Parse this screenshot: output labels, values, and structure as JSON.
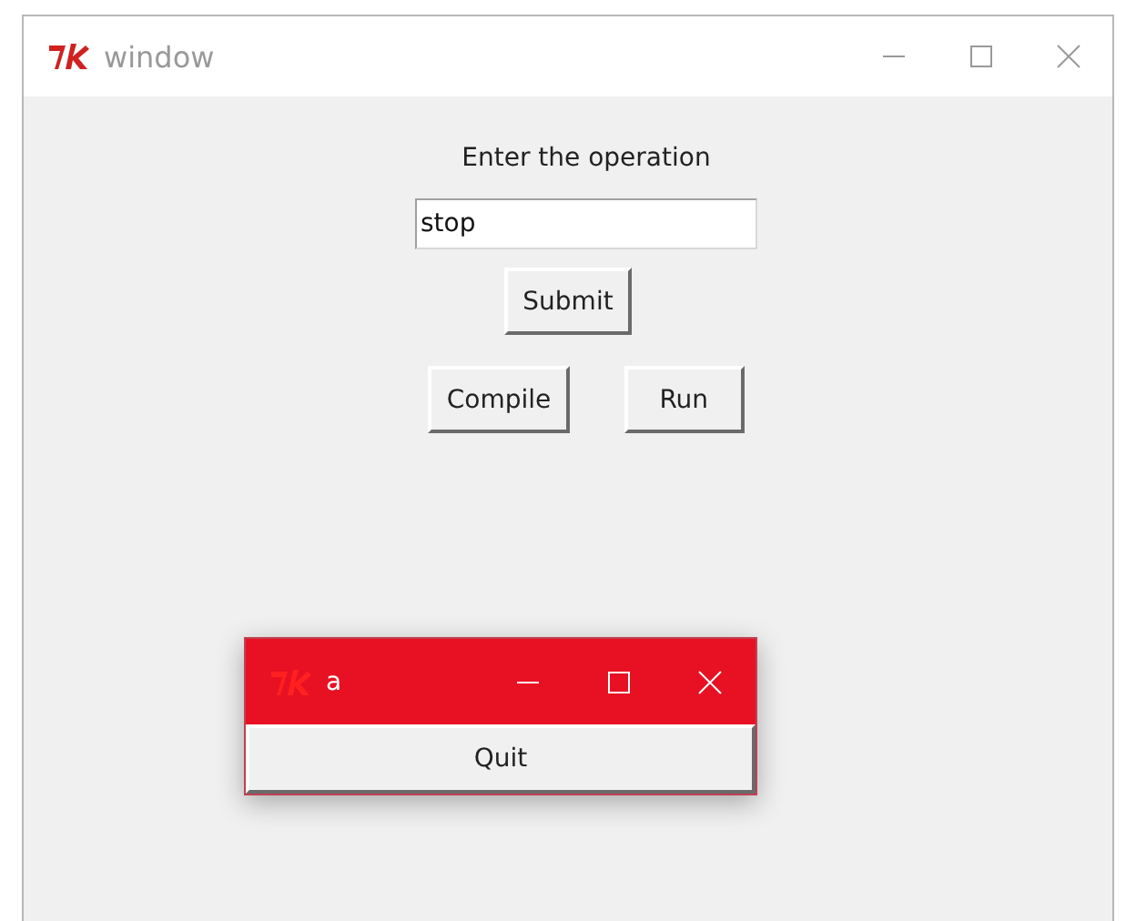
{
  "window": {
    "title": "window",
    "active": false
  },
  "form": {
    "label": "Enter the operation",
    "entry": {
      "value": "stop"
    },
    "submit": "Submit",
    "buttons": [
      "Compile",
      "Run"
    ]
  },
  "popup": {
    "title": "a",
    "active": true,
    "button": "Quit"
  }
}
